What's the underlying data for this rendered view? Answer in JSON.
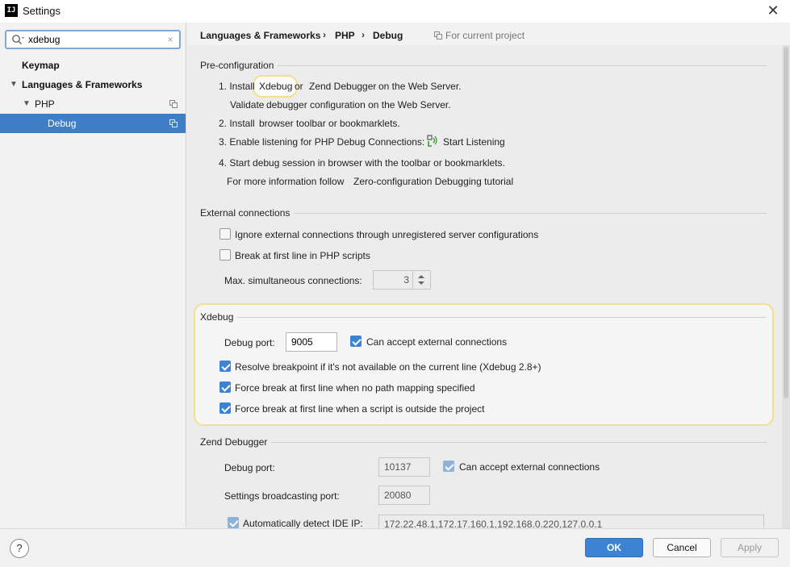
{
  "window": {
    "title": "Settings",
    "app_icon": "IJ"
  },
  "search": {
    "value": "xdebug",
    "clear": "×"
  },
  "sidebar": {
    "items": [
      {
        "label": "Keymap"
      },
      {
        "label": "Languages & Frameworks"
      },
      {
        "label": "PHP"
      },
      {
        "label": "Debug"
      }
    ]
  },
  "breadcrumb": {
    "items": [
      "Languages & Frameworks",
      "PHP",
      "Debug"
    ],
    "separator": "›",
    "scope": "For current project"
  },
  "preconfig": {
    "title": "Pre-configuration",
    "step1_prefix": "1. Install",
    "step1_link1": "Xdebug",
    "step1_or": "or",
    "step1_link2": "Zend Debugger",
    "step1_suffix": "on the Web Server.",
    "validate_link": "Validate",
    "validate_suffix": "debugger configuration on the Web Server.",
    "step2_prefix": "2. Install",
    "step2_link": "browser toolbar or bookmarklets.",
    "step3_text": "3. Enable listening for PHP Debug Connections:",
    "step3_link": "Start Listening",
    "step4_text": "4. Start debug session in browser with the toolbar or bookmarklets.",
    "more_prefix": "For more information follow",
    "more_link": "Zero-configuration Debugging tutorial"
  },
  "external": {
    "title": "External connections",
    "ignore_label": "Ignore external connections through unregistered server configurations",
    "break_label": "Break at first line in PHP scripts",
    "max_label": "Max. simultaneous connections:",
    "max_value": "3"
  },
  "xdebug": {
    "title": "Xdebug",
    "port_label": "Debug port:",
    "port_value": "9005",
    "accept_label": "Can accept external connections",
    "resolve_label": "Resolve breakpoint if it's not available on the current line (Xdebug 2.8+)",
    "force_path_label": "Force break at first line when no path mapping specified",
    "force_outside_label": "Force break at first line when a script is outside the project"
  },
  "zend": {
    "title": "Zend Debugger",
    "port_label": "Debug port:",
    "port_value": "10137",
    "accept_label": "Can accept external connections",
    "broadcast_label": "Settings broadcasting port:",
    "broadcast_value": "20080",
    "autodetect_label": "Automatically detect IDE IP:",
    "ip_value": "172.22.48.1,172.17.160.1,192.168.0.220,127.0.0.1"
  },
  "buttons": {
    "ok": "OK",
    "cancel": "Cancel",
    "apply": "Apply",
    "help": "?"
  },
  "colors": {
    "accent": "#3d83d4",
    "link": "#2f6ea8",
    "selection": "#3d7ec6",
    "highlight": "#f3e08a"
  }
}
